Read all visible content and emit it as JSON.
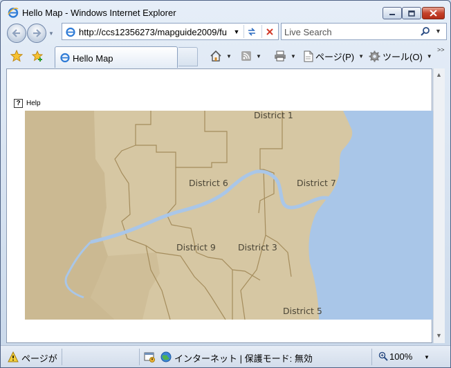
{
  "window": {
    "title": "Hello Map - Windows Internet Explorer"
  },
  "address": {
    "url": "http://ccs12356273/mapguide2009/fu"
  },
  "search": {
    "placeholder": "Live Search"
  },
  "tabs": [
    {
      "label": "Hello Map"
    }
  ],
  "commands": {
    "page_label": "ページ(P)",
    "tools_label": "ツール(O)",
    "more": ">>"
  },
  "content": {
    "help_label": "Help",
    "map": {
      "colors": {
        "land": "#d6c7a3",
        "water": "#a9c6e8",
        "border": "#a48c5c",
        "label": "#4a4536"
      },
      "districts": [
        {
          "label": "District 1"
        },
        {
          "label": "District 6"
        },
        {
          "label": "District 7"
        },
        {
          "label": "District 9"
        },
        {
          "label": "District 3"
        },
        {
          "label": "District 5"
        }
      ]
    }
  },
  "status": {
    "text": "ページが表示されました",
    "zone": "インターネット | 保護モード: 無効",
    "zoom": "100%"
  }
}
